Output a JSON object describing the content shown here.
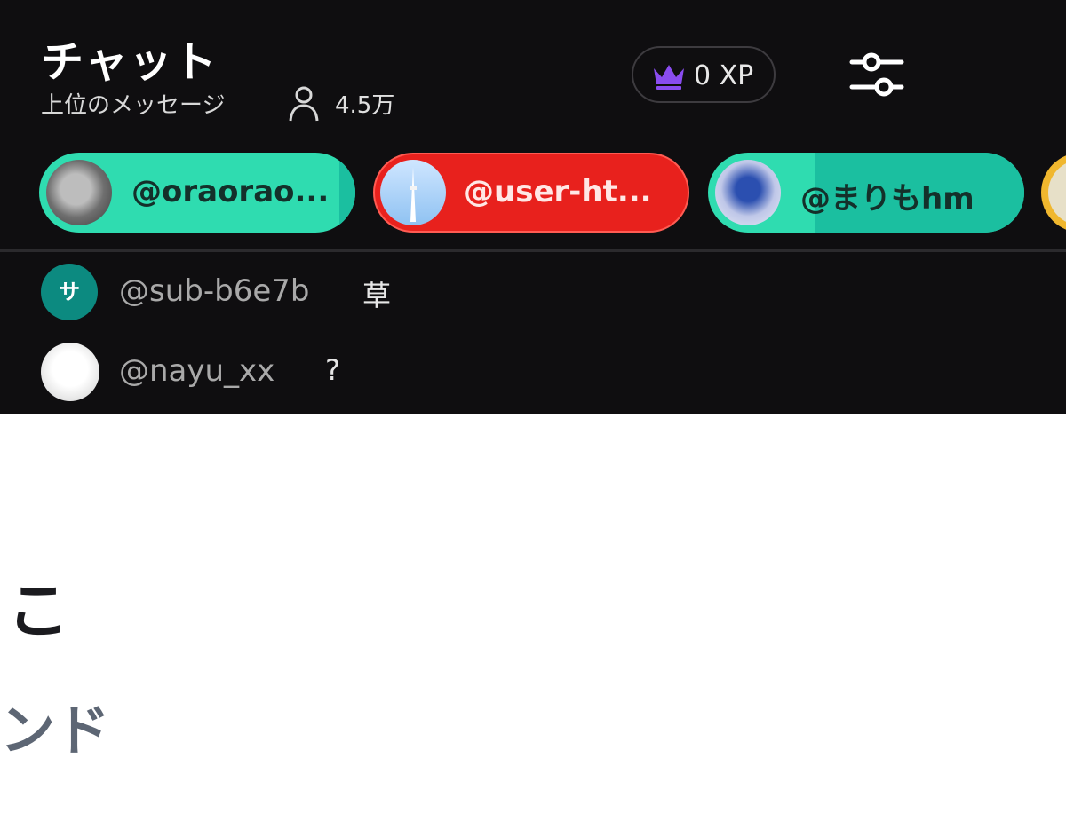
{
  "chat": {
    "title": "チャット",
    "subtitle": "上位のメッセージ",
    "viewer_count": "4.5万",
    "xp_label": "0 XP"
  },
  "colors": {
    "teal_chip": "#2fdcb0",
    "teal_chip_dark": "#1bbfa0",
    "red_chip": "#e8211d",
    "gold_chip": "#f0b72e",
    "crown": "#8a4cf0",
    "panel_bg": "#0f0e10"
  },
  "pinned": [
    {
      "label": "@oraorao..."
    },
    {
      "label": "@user-ht..."
    },
    {
      "label": "@まりもhm"
    }
  ],
  "messages": [
    {
      "avatar_text": "サ",
      "user": "@sub-b6e7b",
      "text": "草"
    },
    {
      "avatar_text": "",
      "user": "@nayu_xx",
      "text": "?"
    }
  ],
  "below": {
    "line1": "こ",
    "line2": "ンド"
  },
  "icons": {
    "viewers": "person-icon",
    "xp": "crown-icon",
    "settings": "sliders-icon"
  }
}
